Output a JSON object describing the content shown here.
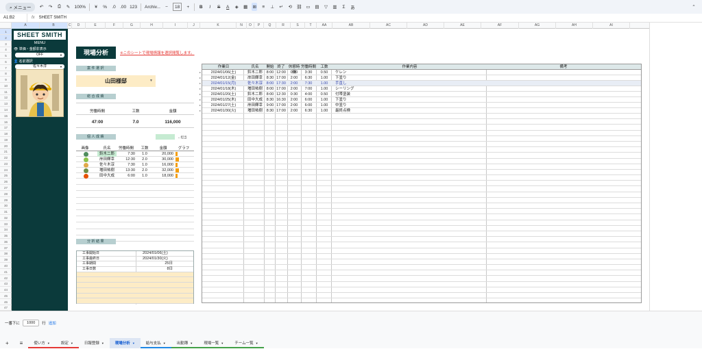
{
  "toolbar": {
    "menu_label": "メニュー",
    "zoom": "100%",
    "currency": "¥",
    "percent": "%",
    "dec_dec": ".0",
    "dec_inc": ".00",
    "format_123": "123",
    "font": "Archiv...",
    "font_size": "18"
  },
  "formula": {
    "cell_ref": "A1:B2",
    "content": "SHEET SMITH"
  },
  "columns": [
    "A",
    "B",
    "C",
    "D",
    "E",
    "F",
    "G",
    "H",
    "I",
    "J",
    "K",
    "N",
    "O",
    "P",
    "Q",
    "R",
    "S",
    "T",
    "AA",
    "AB",
    "AC",
    "AD",
    "AE",
    "AF",
    "AG",
    "AH",
    "AI"
  ],
  "rows": [
    "1",
    "2",
    "3",
    "4",
    "5",
    "6",
    "7",
    "8",
    "9",
    "10",
    "11",
    "12",
    "13",
    "14",
    "15",
    "16",
    "17",
    "18",
    "19",
    "20",
    "21",
    "22",
    "23",
    "24",
    "25",
    "26",
    "27",
    "28",
    "29",
    "30",
    "31",
    "32",
    "33",
    "34",
    "35",
    "36",
    "37",
    "38",
    "39",
    "40",
    "41",
    "42",
    "43",
    "44",
    "45",
    "46",
    "47"
  ],
  "sidebar": {
    "logo": "SHEET SMITH",
    "menu": "MENU",
    "price_toggle_label": "単価・金額非表示",
    "price_toggle_value": "OFF",
    "name_select_label": "名前選択",
    "name_select_value": "佐々木淳"
  },
  "main": {
    "title": "現場分析",
    "notice": "※このシートで現場情報を選択閲覧します。",
    "section_site": "案件選択",
    "site_value": "山田様邸",
    "section_summary": "総合成績",
    "summary": {
      "labels": [
        "労働時間",
        "工数",
        "金額"
      ],
      "values": [
        "47:00",
        "7.0",
        "116,000"
      ]
    },
    "section_person": "個人成績",
    "legend": "←担当",
    "person_headers": [
      "画像",
      "氏名",
      "労働時間",
      "工数",
      "金額",
      "グラフ"
    ],
    "persons": [
      {
        "name": "鈴木二郎",
        "hours": "7:30",
        "kosu": "1.0",
        "amount": "20,000",
        "ratio": 0.625,
        "color": "#4f8c5d",
        "highlight": true
      },
      {
        "name": "岸田輝幸",
        "hours": "12:30",
        "kosu": "2.0",
        "amount": "30,000",
        "ratio": 0.94,
        "color": "#8bc34a",
        "highlight": false
      },
      {
        "name": "佐々木淳",
        "hours": "7:30",
        "kosu": "1.0",
        "amount": "16,000",
        "ratio": 0.5,
        "color": "#e0a94a",
        "highlight": false
      },
      {
        "name": "増田祐樹",
        "hours": "13:30",
        "kosu": "2.0",
        "amount": "32,000",
        "ratio": 1.0,
        "color": "#6d8f45",
        "highlight": false
      },
      {
        "name": "田中大成",
        "hours": "6:00",
        "kosu": "1.0",
        "amount": "18,000",
        "ratio": 0.56,
        "color": "#e65100",
        "highlight": false
      }
    ],
    "section_analysis": "分析結果",
    "analysis": [
      {
        "key": "工事開始日",
        "value": "2024/01/06(土)"
      },
      {
        "key": "工事最終日",
        "value": "2024/01/30(火)"
      },
      {
        "key": "工事期間",
        "value": "25日"
      },
      {
        "key": "工事日数",
        "value": "8日"
      }
    ]
  },
  "work": {
    "headers": [
      "作業日",
      "氏名",
      "開始",
      "終了",
      "休憩時間",
      "労働時間",
      "工数",
      "作業内容",
      "備考"
    ],
    "rows": [
      [
        "2024/01/06(土)",
        "鈴木二郎",
        "8:00",
        "12:00",
        "0:30",
        "3:30",
        "0.50",
        "ケレン",
        ""
      ],
      [
        "2024/01/12(金)",
        "岸田輝幸",
        "8:30",
        "17:00",
        "2:00",
        "6:30",
        "1.00",
        "下塗り",
        ""
      ],
      [
        "2024/01/15(月)",
        "佐々木淳",
        "8:00",
        "17:30",
        "2:00",
        "7:30",
        "1.00",
        "手直し",
        ""
      ],
      [
        "2024/01/18(木)",
        "増田祐樹",
        "8:00",
        "17:00",
        "2:00",
        "7:00",
        "1.00",
        "シーリング",
        ""
      ],
      [
        "2024/01/20(土)",
        "鈴木二郎",
        "8:00",
        "12:30",
        "0:30",
        "4:00",
        "0.50",
        "付帯塗装",
        ""
      ],
      [
        "2024/01/25(木)",
        "田中大成",
        "8:30",
        "16:30",
        "2:00",
        "6:00",
        "1.00",
        "下塗り",
        ""
      ],
      [
        "2024/01/27(土)",
        "岸田輝幸",
        "9:00",
        "17:00",
        "2:00",
        "6:00",
        "1.00",
        "中塗り",
        ""
      ],
      [
        "2024/01/30(火)",
        "増田祐樹",
        "8:30",
        "17:00",
        "2:00",
        "6:30",
        "1.00",
        "最終点検",
        ""
      ]
    ],
    "selected_row": 2
  },
  "bottom": {
    "prefix": "一番下に",
    "count": "1000",
    "unit": "行",
    "add": "追加"
  },
  "tabs": [
    {
      "label": "使い方",
      "active": false,
      "color": "#e53935"
    },
    {
      "label": "設定",
      "active": false,
      "color": "#e53935"
    },
    {
      "label": "日報登録",
      "active": false,
      "color": ""
    },
    {
      "label": "現場分析",
      "active": true,
      "color": ""
    },
    {
      "label": "給与支払",
      "active": false,
      "color": "#1e88e5"
    },
    {
      "label": "出勤簿",
      "active": false,
      "color": "#43a047"
    },
    {
      "label": "現場一覧",
      "active": false,
      "color": "#43a047"
    },
    {
      "label": "チーム一覧",
      "active": false,
      "color": "#43a047"
    }
  ]
}
